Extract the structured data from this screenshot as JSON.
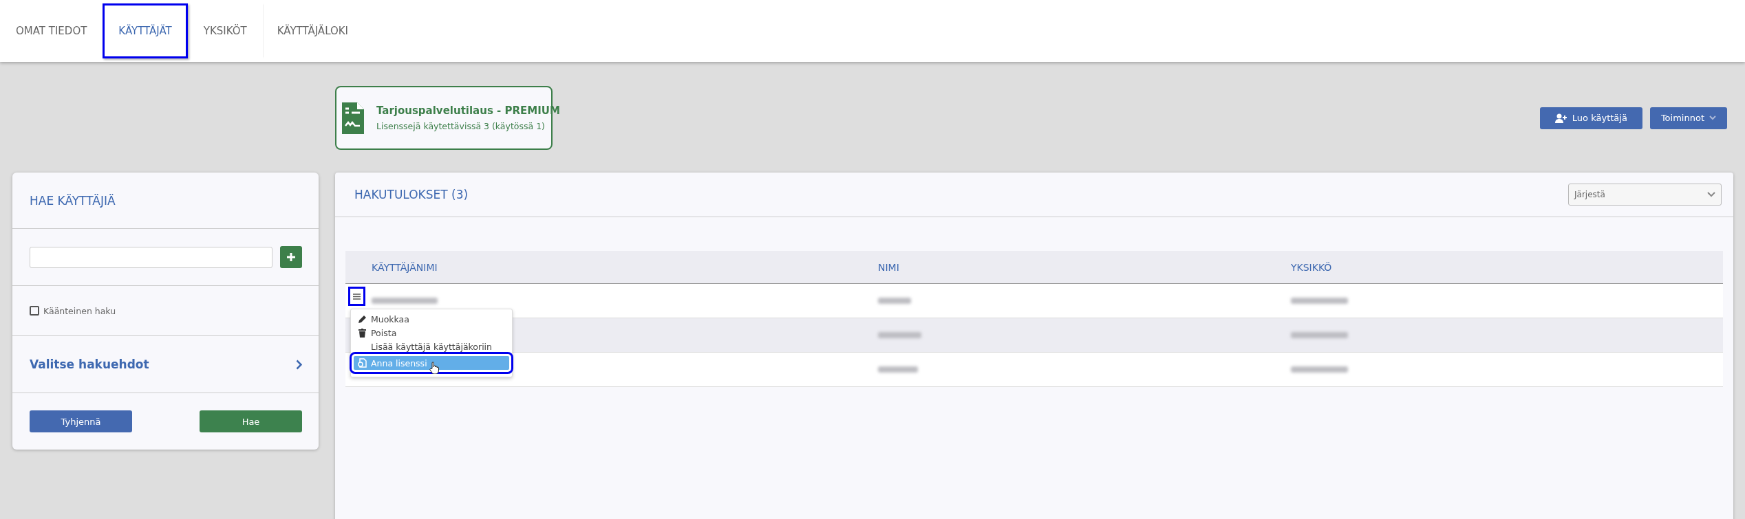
{
  "tabs": [
    {
      "label": "OMAT TIEDOT",
      "selected": false,
      "outlined": false
    },
    {
      "label": "KÄYTTÄJÄT",
      "selected": true,
      "outlined": true
    },
    {
      "label": "YKSIKÖT",
      "selected": false,
      "outlined": false
    },
    {
      "label": "KÄYTTÄJÄLOKI",
      "selected": false,
      "outlined": false
    }
  ],
  "license": {
    "title": "Tarjouspalvelutilaus - PREMIUM",
    "subtitle": "Lisenssejä käytettävissä 3 (käytössä 1)"
  },
  "actions": [
    {
      "label": "Luo käyttäjä",
      "kind": "create"
    },
    {
      "label": "Toiminnot",
      "kind": "dropdown"
    }
  ],
  "search_panel": {
    "title": "HAE KÄYTTÄJIÄ",
    "checkbox": {
      "label": "Käänteinen haku",
      "checked": false
    },
    "criteria": "Valitse hakuehdot",
    "buttons": [
      {
        "label": "Tyhjennä",
        "kind": "secondary"
      },
      {
        "label": "Hae",
        "kind": "primary"
      }
    ]
  },
  "results": {
    "title": "HAKUTULOKSET (3)",
    "sort": {
      "label": "Järjestä"
    },
    "columns": [
      "KÄYTTÄJÄNIMI",
      "NIMI",
      "YKSIKKÖ"
    ],
    "rows": [
      {
        "striped": false
      },
      {
        "striped": true
      },
      {
        "striped": false
      }
    ],
    "menu_button": {
      "outlined": true
    },
    "row_menu": [
      {
        "label": "Muokkaa",
        "kind": "edit",
        "selected": false,
        "outlined": false
      },
      {
        "label": "Poista",
        "kind": "delete",
        "selected": false,
        "outlined": false
      },
      {
        "label": "Lisää käyttäjä käyttäjäkoriin",
        "kind": "plain",
        "selected": false,
        "outlined": false
      },
      {
        "label": "Anna lisenssi",
        "kind": "license",
        "selected": true,
        "outlined": true
      }
    ]
  }
}
